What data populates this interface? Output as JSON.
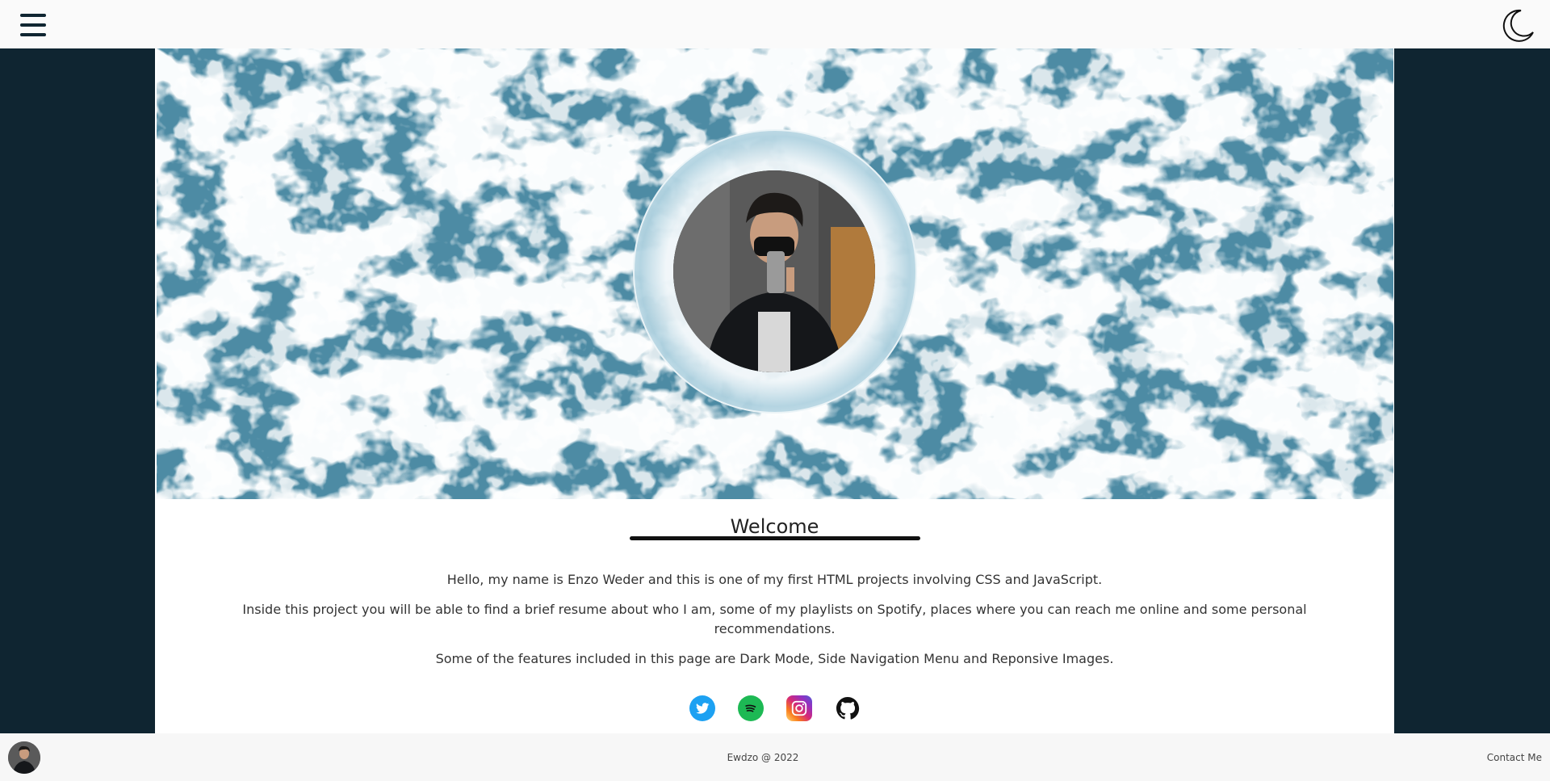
{
  "header": {
    "menu_icon": "hamburger-menu-icon",
    "theme_icon": "moon-icon"
  },
  "hero": {
    "background": "ocean-foam-image",
    "profile_photo": "profile-photo"
  },
  "main": {
    "heading": "Welcome",
    "paragraphs": [
      "Hello, my name is Enzo Weder and this is one of my first HTML projects involving CSS and JavaScript.",
      "Inside this project you will be able to find a brief resume about who I am, some of my playlists on Spotify, places where you can reach me online and some personal recommendations.",
      "Some of the features included in this page are Dark Mode, Side Navigation Menu and Reponsive Images."
    ],
    "socials": [
      {
        "name": "twitter-icon",
        "color": "#1da1f2"
      },
      {
        "name": "spotify-icon",
        "color": "#1db954"
      },
      {
        "name": "instagram-icon",
        "color": "#e1306c"
      },
      {
        "name": "github-icon",
        "color": "#111111"
      }
    ]
  },
  "footer": {
    "copyright": "Ewdzo @ 2022",
    "contact": "Contact Me"
  },
  "colors": {
    "side_background": "#0f2531",
    "bar_background": "#fafafa"
  }
}
